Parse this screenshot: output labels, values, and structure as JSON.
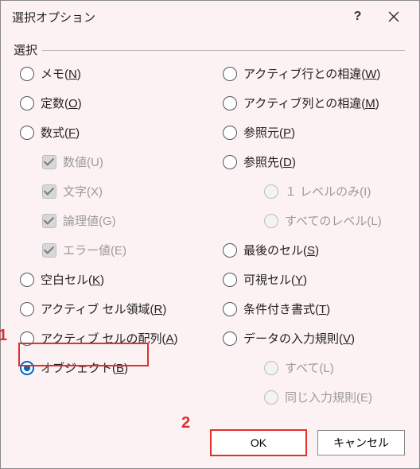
{
  "title": "選択オプション",
  "group_label": "選択",
  "left": [
    {
      "label": "メモ(",
      "key": "N",
      "tail": ")",
      "type": "radio"
    },
    {
      "label": "定数(",
      "key": "O",
      "tail": ")",
      "type": "radio"
    },
    {
      "label": "数式(",
      "key": "F",
      "tail": ")",
      "type": "radio"
    },
    {
      "label": "数値(U)",
      "type": "check",
      "indent": 1,
      "disabled": true
    },
    {
      "label": "文字(X)",
      "type": "check",
      "indent": 1,
      "disabled": true
    },
    {
      "label": "論理値(G)",
      "type": "check",
      "indent": 1,
      "disabled": true
    },
    {
      "label": "エラー値(E)",
      "type": "check",
      "indent": 1,
      "disabled": true
    },
    {
      "label": "空白セル(",
      "key": "K",
      "tail": ")",
      "type": "radio"
    },
    {
      "label": "アクティブ セル領域(",
      "key": "R",
      "tail": ")",
      "type": "radio"
    },
    {
      "label": "アクティブ セルの配列(",
      "key": "A",
      "tail": ")",
      "type": "radio"
    },
    {
      "label": "オブジェクト(",
      "key": "B",
      "tail": ")",
      "type": "radio",
      "selected": true
    }
  ],
  "right": [
    {
      "label": "アクティブ行との相違(",
      "key": "W",
      "tail": ")",
      "type": "radio"
    },
    {
      "label": "アクティブ列との相違(",
      "key": "M",
      "tail": ")",
      "type": "radio"
    },
    {
      "label": "参照元(",
      "key": "P",
      "tail": ")",
      "type": "radio"
    },
    {
      "label": "参照先(",
      "key": "D",
      "tail": ")",
      "type": "radio"
    },
    {
      "label": "１ レベルのみ(I)",
      "type": "radio",
      "indent": 2,
      "disabled": true
    },
    {
      "label": "すべてのレベル(L)",
      "type": "radio",
      "indent": 2,
      "disabled": true
    },
    {
      "label": "最後のセル(",
      "key": "S",
      "tail": ")",
      "type": "radio"
    },
    {
      "label": "可視セル(",
      "key": "Y",
      "tail": ")",
      "type": "radio"
    },
    {
      "label": "条件付き書式(",
      "key": "T",
      "tail": ")",
      "type": "radio"
    },
    {
      "label": "データの入力規則(",
      "key": "V",
      "tail": ")",
      "type": "radio"
    },
    {
      "label": "すべて(L)",
      "type": "radio",
      "indent": 2,
      "disabled": true
    },
    {
      "label": "同じ入力規則(E)",
      "type": "radio",
      "indent": 2,
      "disabled": true
    }
  ],
  "buttons": {
    "ok": "OK",
    "cancel": "キャンセル"
  },
  "callouts": {
    "n1": "1",
    "n2": "2"
  }
}
